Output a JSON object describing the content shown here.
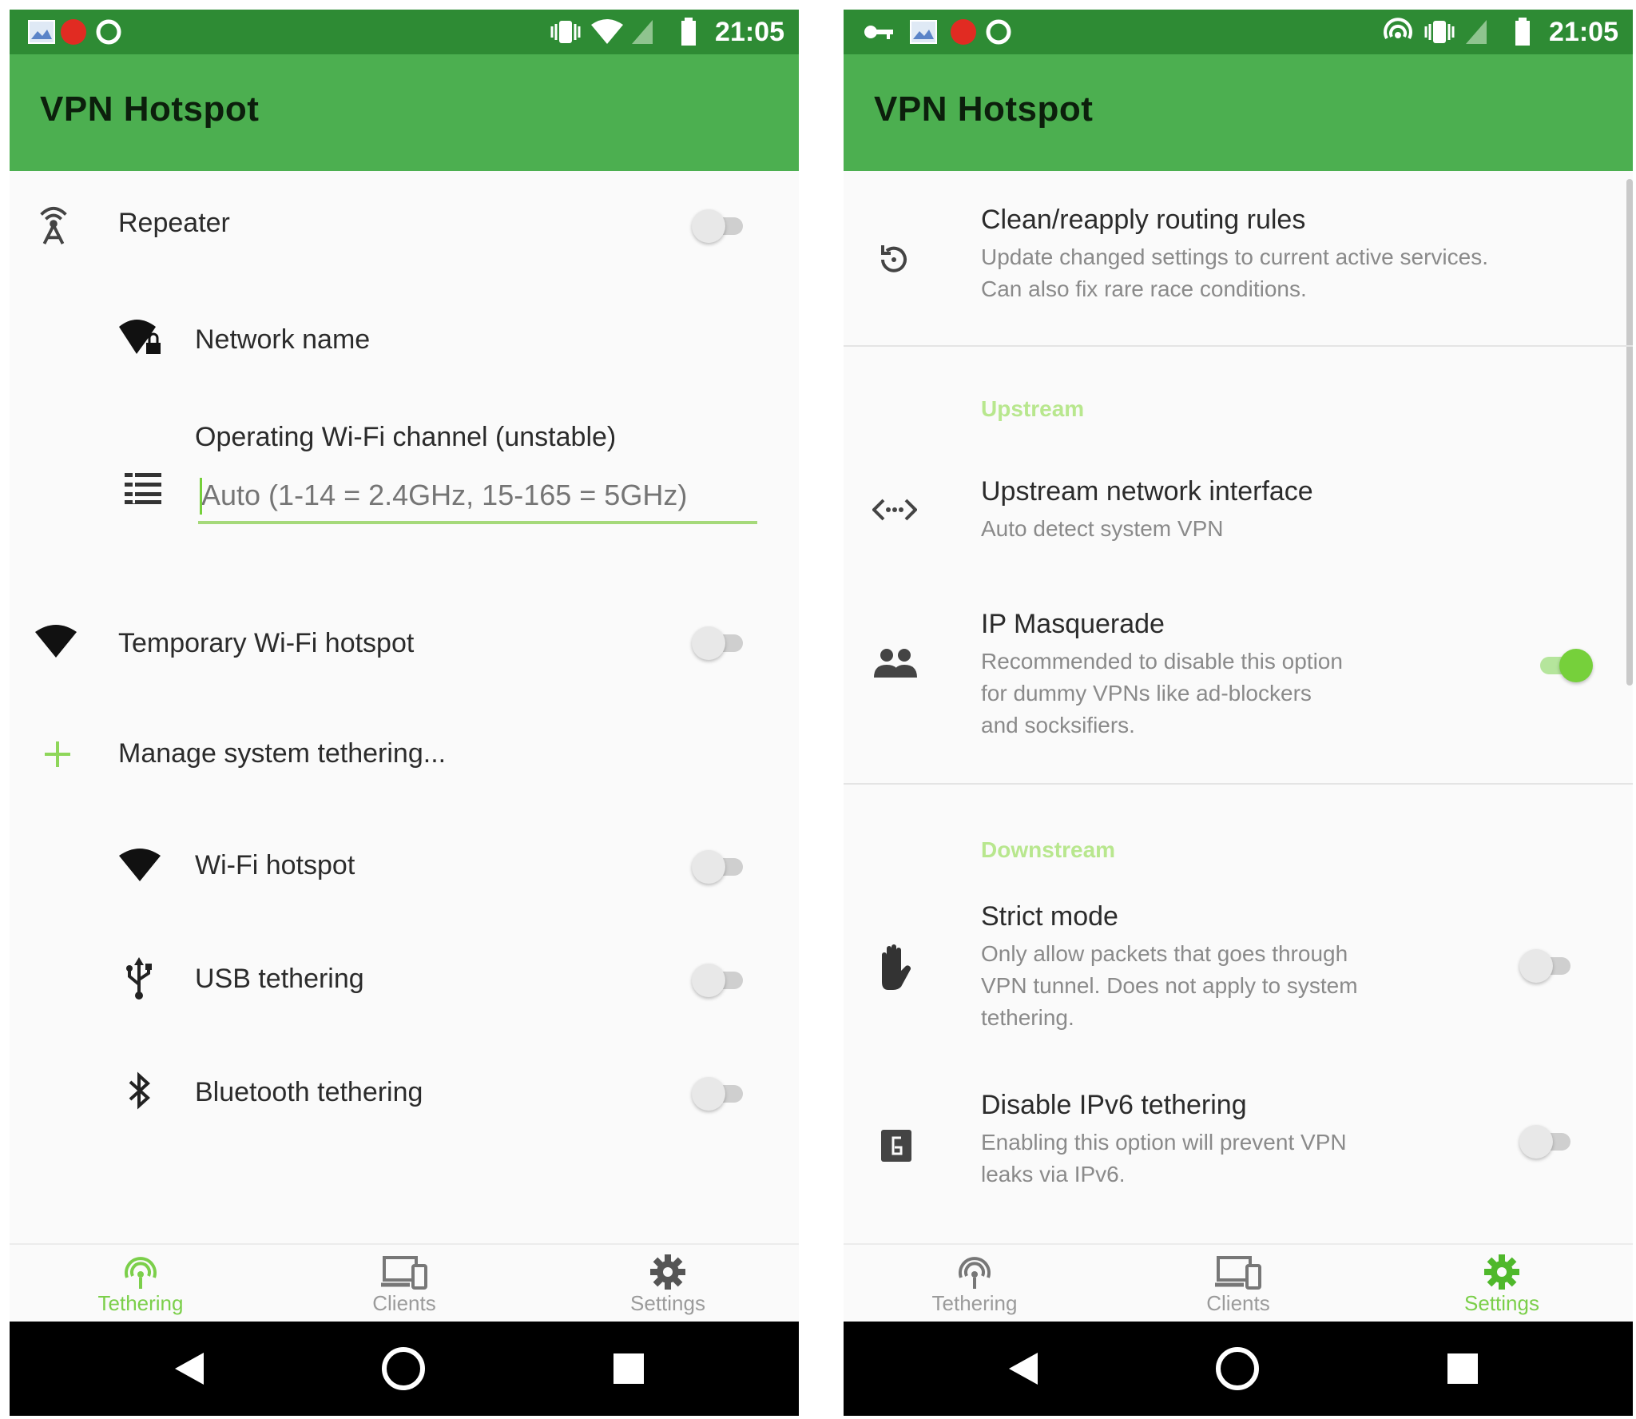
{
  "left": {
    "status": {
      "time": "21:05"
    },
    "appbar": {
      "title": "VPN Hotspot"
    },
    "items": {
      "repeater": {
        "label": "Repeater",
        "on": false
      },
      "network_name": {
        "label": "Network name"
      },
      "channel": {
        "label": "Operating Wi-Fi channel (unstable)",
        "placeholder": "Auto (1-14 = 2.4GHz, 15-165 = 5GHz)"
      },
      "temp_hotspot": {
        "label": "Temporary Wi-Fi hotspot",
        "on": false
      },
      "manage": {
        "label": "Manage system tethering..."
      },
      "wifi_hotspot": {
        "label": "Wi-Fi hotspot",
        "on": false
      },
      "usb": {
        "label": "USB tethering",
        "on": false
      },
      "bluetooth": {
        "label": "Bluetooth tethering",
        "on": false
      }
    },
    "nav": {
      "tethering": "Tethering",
      "clients": "Clients",
      "settings": "Settings",
      "active": "tethering"
    }
  },
  "right": {
    "status": {
      "time": "21:05"
    },
    "appbar": {
      "title": "VPN Hotspot"
    },
    "items": {
      "clean": {
        "label": "Clean/reapply routing rules",
        "summary_1": "Update changed settings to current active services.",
        "summary_2": "Can also fix rare race conditions."
      },
      "upstream_header": "Upstream",
      "upstream_iface": {
        "label": "Upstream network interface",
        "summary": "Auto detect system VPN"
      },
      "masquerade": {
        "label": "IP Masquerade",
        "summary_1": "Recommended to disable this option",
        "summary_2": "for dummy VPNs like ad-blockers",
        "summary_3": "and socksifiers.",
        "on": true
      },
      "downstream_header": "Downstream",
      "strict": {
        "label": "Strict mode",
        "summary_1": "Only allow packets that goes through",
        "summary_2": "VPN tunnel. Does not apply to system",
        "summary_3": "tethering.",
        "on": false
      },
      "ipv6": {
        "label": "Disable IPv6 tethering",
        "summary_1": "Enabling this option will prevent VPN",
        "summary_2": "leaks via IPv6.",
        "on": false
      }
    },
    "nav": {
      "tethering": "Tethering",
      "clients": "Clients",
      "settings": "Settings",
      "active": "settings"
    }
  },
  "colors": {
    "statusbar": "#2e8b34",
    "appbar": "#4caf50",
    "accent": "#76d03b",
    "category": "#b8e78e"
  }
}
